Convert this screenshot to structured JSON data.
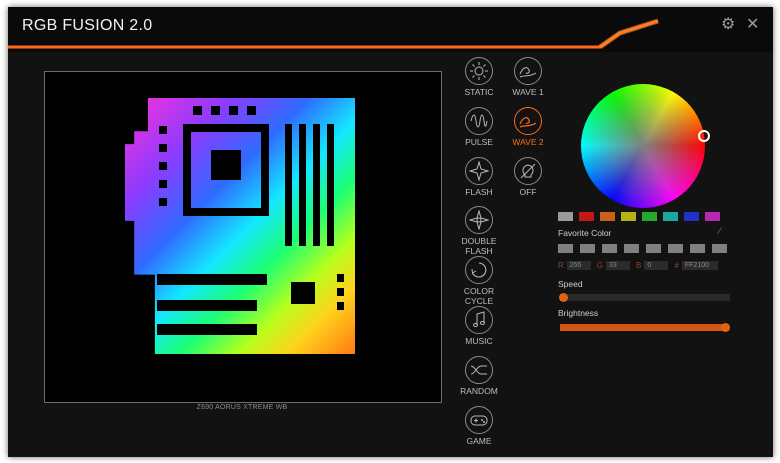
{
  "app": {
    "title": "RGB FUSION 2.0",
    "settings_icon": "gear-icon",
    "close_icon": "close-icon",
    "close_glyph": "✕",
    "settings_glyph": "⚙"
  },
  "preview": {
    "model_label": "Z690 AORUS XTREME WB"
  },
  "modes": [
    {
      "id": "static",
      "label": "STATIC",
      "icon": "sun-icon",
      "active": false
    },
    {
      "id": "wave1",
      "label": "WAVE 1",
      "icon": "wave-icon",
      "active": false
    },
    {
      "id": "pulse",
      "label": "PULSE",
      "icon": "pulse-icon",
      "active": false
    },
    {
      "id": "wave2",
      "label": "WAVE 2",
      "icon": "wave-icon",
      "active": true
    },
    {
      "id": "flash",
      "label": "FLASH",
      "icon": "flash-star-icon",
      "active": false
    },
    {
      "id": "off",
      "label": "OFF",
      "icon": "bulb-off-icon",
      "active": false
    },
    {
      "id": "double_flash",
      "label": "DOUBLE FLASH",
      "icon": "double-flash-icon",
      "active": false
    },
    {
      "id": "color_cycle",
      "label": "COLOR CYCLE",
      "icon": "color-cycle-icon",
      "active": false
    },
    {
      "id": "music",
      "label": "MUSIC",
      "icon": "music-note-icon",
      "active": false
    },
    {
      "id": "random",
      "label": "RANDOM",
      "icon": "random-icon",
      "active": false
    },
    {
      "id": "game",
      "label": "GAME",
      "icon": "gamepad-icon",
      "active": false
    }
  ],
  "color": {
    "accent": "#ff6a1a",
    "swatches": [
      "#9a9a9a",
      "#c41818",
      "#c8621a",
      "#b8b218",
      "#26a82e",
      "#1aa8a0",
      "#2230c8",
      "#b428b4"
    ],
    "favorite_label": "Favorite Color",
    "favorites": [
      "#808080",
      "#808080",
      "#808080",
      "#808080",
      "#808080",
      "#808080",
      "#808080",
      "#808080"
    ],
    "r_label": "R",
    "r": "255",
    "g_label": "G",
    "g": "33",
    "b_label": "B",
    "b": "0",
    "hex_label": "#",
    "hex": "FF2100"
  },
  "speed": {
    "label": "Speed",
    "value": 0.02
  },
  "brightness": {
    "label": "Brightness",
    "value": 0.97
  }
}
